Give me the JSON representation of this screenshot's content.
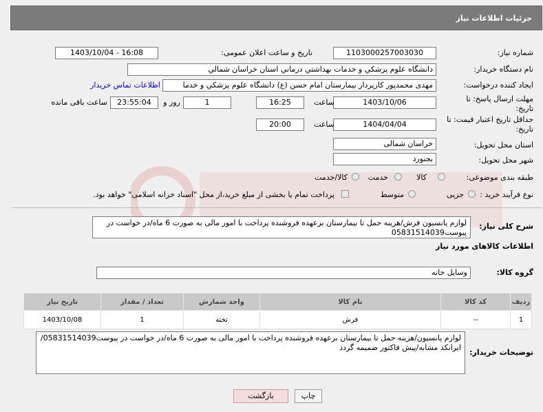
{
  "header": {
    "title": "جزئیات اطلاعات نیاز"
  },
  "fields": {
    "need_number_label": "شماره نیاز:",
    "need_number": "1103000257003030",
    "announce_label": "تاریخ و ساعت اعلان عمومی:",
    "announce_value": "1403/10/04 - 16:08",
    "buyer_label": "نام دستگاه خریدار:",
    "buyer_value": "دانشگاه علوم پزشکي و خدمات بهداشتي درماني استان خراسان شمالي",
    "creator_label": "ایجاد کننده درخواست:",
    "creator_value": "مهدی محمدپور کارپرداز بیمارستان امام حسن (ع) دانشگاه علوم پزشکي و خدما",
    "contact_link": "اطلاعات تماس خریدار",
    "deadline_label": "مهلت ارسال پاسخ: تا تاریخ:",
    "deadline_date": "1403/10/06",
    "time_label": "ساعت",
    "deadline_time": "16:25",
    "days_value": "1",
    "days_label": "روز و",
    "remaining_value": "23:55:04",
    "remaining_label": "ساعت باقی مانده",
    "validity_label": "حداقل تاریخ اعتبار قیمت: تا تاریخ:",
    "validity_date": "1404/04/04",
    "validity_time": "20:00",
    "province_label": "استان محل تحویل:",
    "province_value": "خراسان شمالی",
    "city_label": "شهر محل تحویل:",
    "city_value": "بجنورد",
    "category_label": "طبقه بندی موضوعی:",
    "category_options": [
      "کالا",
      "خدمت",
      "کالا/خدمت"
    ],
    "process_label": "نوع فرآیند خرید :",
    "process_options": [
      "جزیی",
      "متوسط"
    ],
    "process_note": "پرداخت تمام یا بخشی از مبلغ خرید،از محل \"اسناد خزانه اسلامی\" خواهد بود."
  },
  "summary": {
    "label": "شرح کلی نیاز:",
    "text": "لوازم پانسیون فرش/هزینه حمل تا بیمارستان برعهده فروشنده پرداخت با امور مالی به صورت 6 ماه/در خواست در پیوست05831514039"
  },
  "goods_section": {
    "title": "اطلاعات کالاهای مورد نیاز",
    "group_label": "گروه کالا:",
    "group_value": "وسایل خانه"
  },
  "goods_table": {
    "headers": [
      "ردیف",
      "کد کالا",
      "نام کالا",
      "واحد شمارش",
      "تعداد / مقدار",
      "تاریخ نیاز"
    ],
    "rows": [
      [
        "1",
        "--",
        "فرش",
        "تخته",
        "1",
        "1403/10/08"
      ]
    ]
  },
  "buyer_notes": {
    "label": "توضیحات خریدار:",
    "text": "لوازم پانسیون/هزینه حمل تا بیمارستان برعهده فروشنده پرداخت با امور مالی به صورت 6 ماه/در خواست در پیوست05831514039/ایرانکد مشابه/پیش فاکتور ضمیمه گردد"
  },
  "buttons": {
    "print": "چاپ",
    "back": "بازگشت"
  },
  "colors": {
    "header_bg": "#7b7b7b",
    "back_button_bg": "#f7dede",
    "link": "#0000cc"
  }
}
